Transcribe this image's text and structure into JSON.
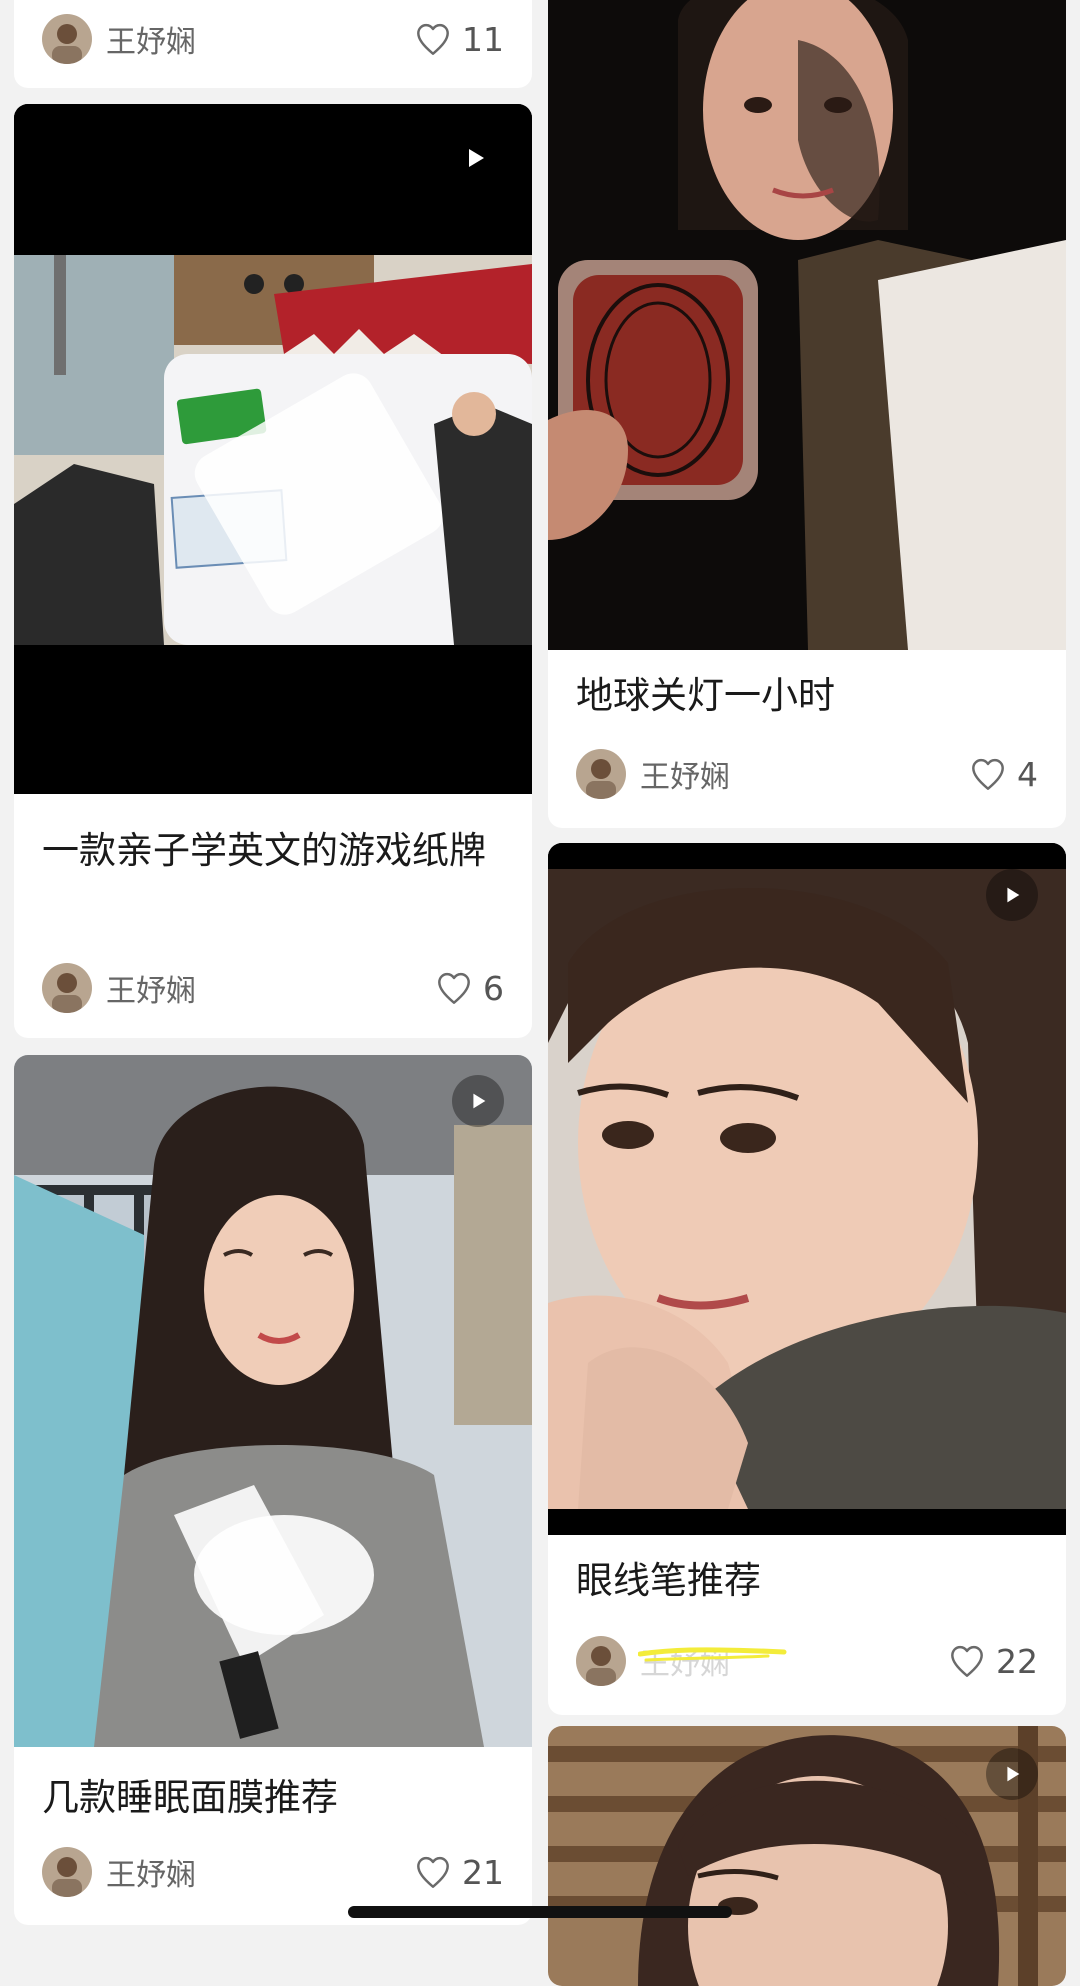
{
  "feed": {
    "cards": [
      {
        "title": "",
        "author": "王妤娴",
        "likes": "11",
        "has_video": false
      },
      {
        "title": "一款亲子学英文的游戏纸牌",
        "author": "王妤娴",
        "likes": "6",
        "has_video": true
      },
      {
        "title": "几款睡眠面膜推荐",
        "author": "王妤娴",
        "likes": "21",
        "has_video": true
      },
      {
        "title": "地球关灯一小时",
        "author": "王妤娴",
        "likes": "4",
        "has_video": false
      },
      {
        "title": "眼线笔推荐",
        "author": "王妤娴",
        "likes": "22",
        "has_video": true
      },
      {
        "title": "",
        "author": "",
        "likes": "",
        "has_video": true
      }
    ]
  },
  "icons": {
    "like": "heart-outline-icon",
    "play": "play-icon"
  },
  "colors": {
    "background": "#f2f2f2",
    "card": "#ffffff",
    "text_primary": "#1a1a1a",
    "text_secondary": "#666666",
    "highlight_mark": "#f3ec3a"
  }
}
